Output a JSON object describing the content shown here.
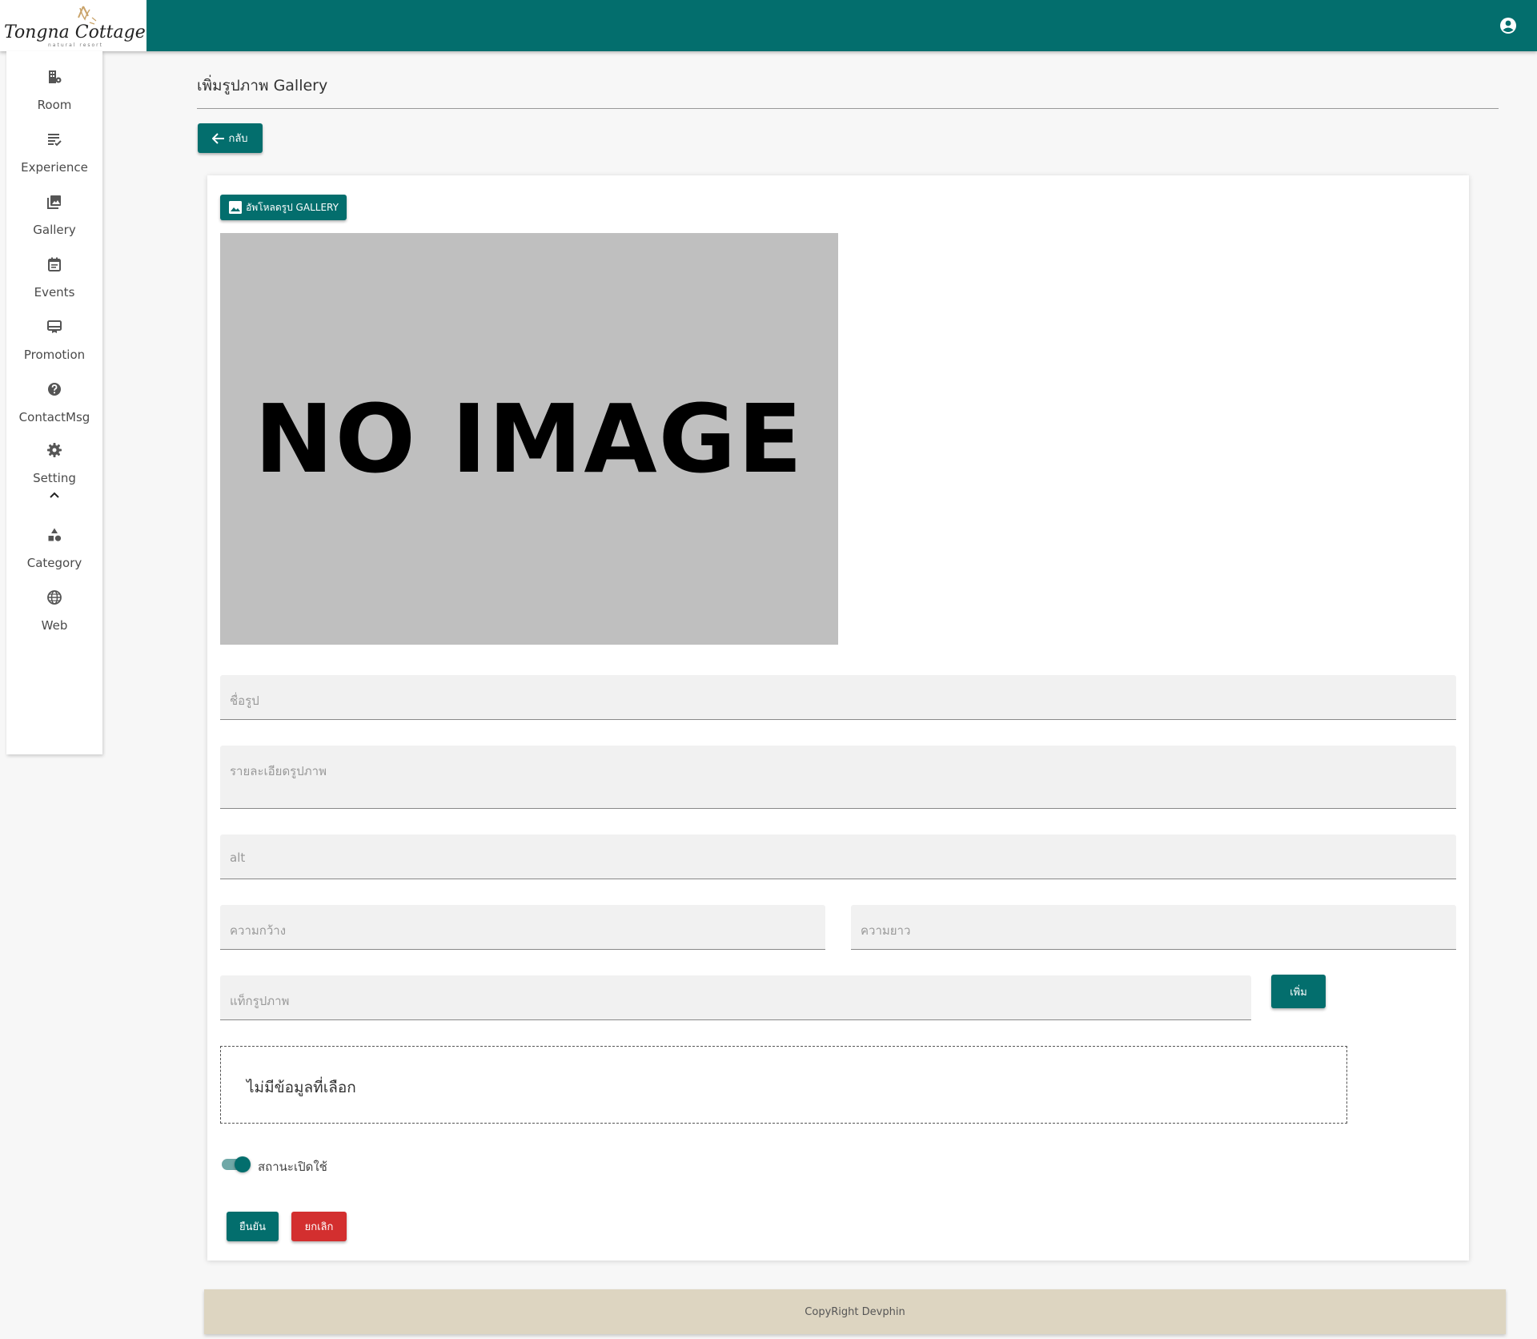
{
  "brand": {
    "logo_text": "Tongna Cottage",
    "logo_tagline": "natural resort",
    "topbar_color": "#036e6d"
  },
  "header": {
    "account_icon": "account-circle-icon"
  },
  "sidebar": {
    "items": [
      {
        "label": "Room",
        "icon": "room-building-icon"
      },
      {
        "label": "Experience",
        "icon": "list-check-icon"
      },
      {
        "label": "Gallery",
        "icon": "image-gallery-icon"
      },
      {
        "label": "Events",
        "icon": "calendar-icon"
      },
      {
        "label": "Promotion",
        "icon": "card-membership-icon"
      },
      {
        "label": "ContactMsg",
        "icon": "help-icon"
      },
      {
        "label": "Setting",
        "icon": "gear-icon"
      },
      {
        "label": "Category",
        "icon": "category-shapes-icon"
      },
      {
        "label": "Web",
        "icon": "globe-icon"
      }
    ],
    "collapse_icon": "chevron-up-icon"
  },
  "main": {
    "title": "เพิ่มรูปภาพ Gallery",
    "back_label": "กลับ",
    "upload_label": "อัพโหลดรูป GALLERY",
    "no_image_text": "NO IMAGE",
    "fields": {
      "name_placeholder": "ชื่อรูป",
      "description_placeholder": "รายละเอียดรูปภาพ",
      "alt_placeholder": "alt",
      "width_placeholder": "ความกว้าง",
      "length_placeholder": "ความยาว",
      "tag_placeholder": "แท็กรูปภาพ"
    },
    "add_label": "เพิ่ม",
    "tags_empty_text": "ไม่มีข้อมูลที่เลือก",
    "status_label": "สถานะเปิดใช้",
    "status_enabled": true,
    "confirm_label": "ยืนยัน",
    "cancel_label": "ยกเลิก"
  },
  "footer": {
    "copyright": "CopyRight Devphin"
  },
  "colors": {
    "accent": "#036e6d",
    "danger": "#d32f2f",
    "footer_bg": "#ddd5c1"
  }
}
